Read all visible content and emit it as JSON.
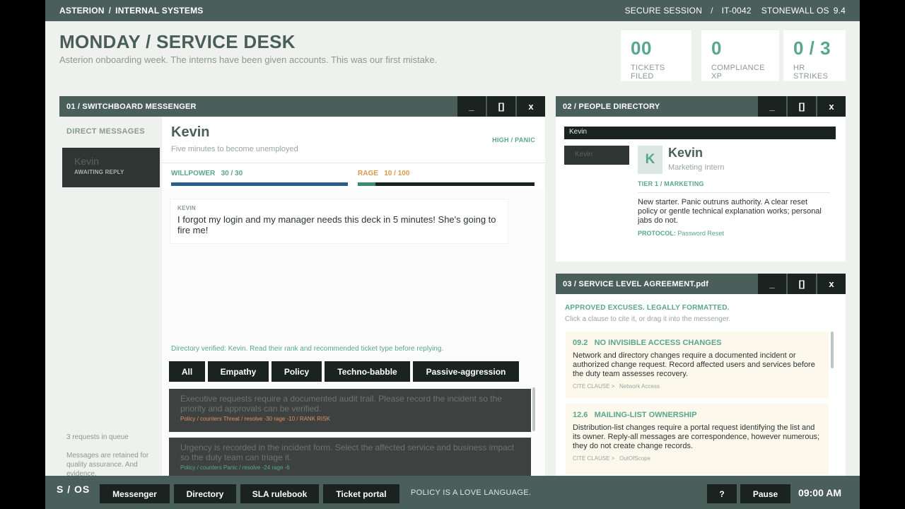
{
  "topbar": {
    "company": "ASTERION",
    "section": "INTERNAL SYSTEMS",
    "session": "SECURE SESSION",
    "terminal": "IT-0042",
    "os": "STONEWALL OS",
    "version": "9.4"
  },
  "header": {
    "title": "MONDAY / SERVICE DESK",
    "subtitle": "Asterion onboarding week. The interns have been given accounts. This was our first mistake."
  },
  "stats": [
    {
      "value": "00",
      "label": "TICKETS FILED"
    },
    {
      "value": "0",
      "label": "COMPLIANCE XP"
    },
    {
      "value": "0 / 3",
      "label": "HR STRIKES"
    }
  ],
  "window_buttons": {
    "minimize": "_",
    "maximize": "[]",
    "close": "x"
  },
  "messenger": {
    "title": "01  /  SWITCHBOARD MESSENGER",
    "dm_title": "DIRECT MESSAGES",
    "dm": {
      "name": "Kevin",
      "status": "AWAITING REPLY"
    },
    "queue": "3 requests in queue",
    "retention": "Messages are retained for quality assurance. And evidence.",
    "chat": {
      "name": "Kevin",
      "subtitle": "Five minutes to become unemployed",
      "mood": "HIGH  /  PANIC",
      "willpower_label": "WILLPOWER",
      "willpower_value": "30 / 30",
      "willpower": 1.0,
      "rage_label": "RAGE",
      "rage_value": "10 / 100",
      "rage": 0.1,
      "bubble_sender": "KEVIN",
      "bubble_text": "I forgot my login and my manager needs this deck in 5 minutes! She's going to fire me!",
      "hint": "Directory verified: Kevin. Read their rank and recommended ticket type before replying."
    },
    "filters": [
      "All",
      "Empathy",
      "Policy",
      "Techno-babble",
      "Passive-aggression"
    ],
    "replies": [
      {
        "text": "Executive requests require a documented audit trail. Please record the incident so the priority and approvals can be verified.",
        "meta": "Policy  /  counters Threat  /  resolve -30  rage -10  /  RANK RISK",
        "tone": "orange"
      },
      {
        "text": "Urgency is recorded in the incident form. Select the affected service and business impact so the duty team can triage it.",
        "meta": "Policy  /  counters Panic  /  resolve -24  rage -6",
        "tone": "teal"
      }
    ]
  },
  "directory": {
    "title": "02  /  PEOPLE DIRECTORY",
    "search_value": "Kevin",
    "chip": "Kevin",
    "avatar_letter": "K",
    "name": "Kevin",
    "role": "Marketing Intern",
    "tier": "TIER 1   /   MARKETING",
    "description": "New starter. Panic outruns authority. A clear reset policy or gentle technical explanation works; personal jabs do not.",
    "protocol_label": "PROTOCOL:",
    "protocol_value": "Password Reset"
  },
  "sla": {
    "title": "03  /  SERVICE LEVEL AGREEMENT.pdf",
    "heading": "APPROVED EXCUSES. LEGALLY FORMATTED.",
    "subheading": "Click a clause to cite it, or drag it into the messenger.",
    "clauses": [
      {
        "id": "09.2",
        "title": "NO INVISIBLE ACCESS CHANGES",
        "body": "Network and directory changes require a documented incident or authorized change request. Record affected users and services before the duty team assesses recovery.",
        "cite_label": "CITE CLAUSE  >",
        "tag": "Network Access"
      },
      {
        "id": "12.6",
        "title": "MAILING-LIST OWNERSHIP",
        "body": "Distribution-list changes require a portal request identifying the list and its owner. Reply-all messages are correspondence, however numerous; they do not create change records.",
        "cite_label": "CITE CLAUSE  >",
        "tag": "OutOfScope"
      }
    ]
  },
  "bottombar": {
    "os_logo": "S / OS",
    "nav": [
      "Messenger",
      "Directory",
      "SLA rulebook",
      "Ticket portal"
    ],
    "motto": "POLICY IS A LOVE LANGUAGE.",
    "help": "?",
    "pause": "Pause",
    "clock": "09:00  AM"
  },
  "colors": {
    "accent": "#5aa58f",
    "bar": "#4b5f5a",
    "dark_button": "#1b2321",
    "willpower": "#2b5f8a",
    "rage": "#d99a4e",
    "risk": "#e58d62"
  }
}
